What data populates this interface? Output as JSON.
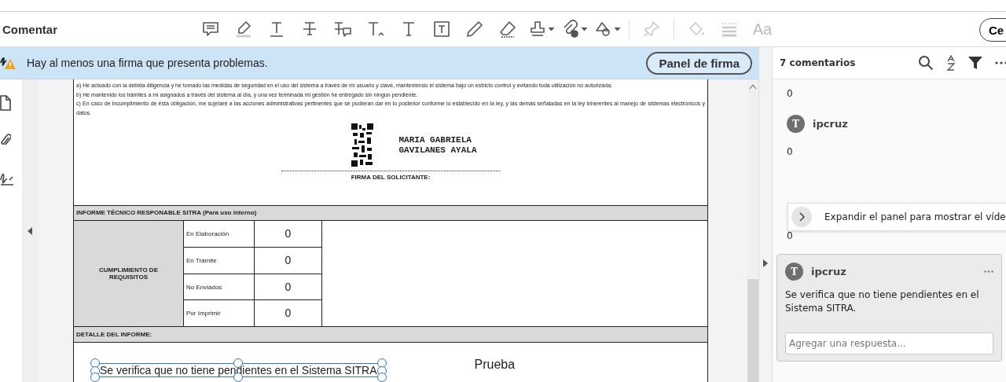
{
  "toolbar": {
    "title": "Comentar",
    "tools": [
      {
        "kind": "note",
        "disabled": false,
        "dropdown": false
      },
      {
        "kind": "highlight",
        "disabled": false,
        "dropdown": false
      },
      {
        "kind": "underline",
        "disabled": false,
        "dropdown": false
      },
      {
        "kind": "strike",
        "disabled": false,
        "dropdown": false
      },
      {
        "kind": "replace",
        "disabled": false,
        "dropdown": false
      },
      {
        "kind": "insert",
        "disabled": false,
        "dropdown": false
      },
      {
        "kind": "text",
        "disabled": false,
        "dropdown": false
      },
      {
        "kind": "textbox",
        "disabled": false,
        "dropdown": false
      },
      {
        "kind": "pencil",
        "disabled": false,
        "dropdown": false
      },
      {
        "kind": "eraser",
        "disabled": false,
        "dropdown": false
      },
      {
        "kind": "stamp",
        "disabled": false,
        "dropdown": true
      },
      {
        "kind": "attach",
        "disabled": false,
        "dropdown": true
      },
      {
        "kind": "shape",
        "disabled": false,
        "dropdown": true
      },
      {
        "kind": "separator"
      },
      {
        "kind": "pin",
        "disabled": true,
        "dropdown": false
      },
      {
        "kind": "separator"
      },
      {
        "kind": "fill",
        "disabled": true,
        "dropdown": false
      },
      {
        "kind": "lines",
        "disabled": true,
        "dropdown": false
      },
      {
        "kind": "font",
        "label": "Aa",
        "disabled": true,
        "dropdown": false
      }
    ],
    "close_button": "Ce"
  },
  "banner": {
    "message": "Hay al menos una firma que presenta problemas.",
    "button": "Panel de firma"
  },
  "document": {
    "paragraphs": [
      "a) He actuado con la debida diligencia y he tomado las medidas de seguridad en el uso del sistema a través de mi usuario y clave, manteniendo el sistema bajo un estricto control y evitando toda utilización no autorizada;",
      "b) He mantenido  los trámites a mi asignados a través del sistema al día, y una vez terminada mi gestión he entregado sin ningún pendiente.",
      "c) En caso de incumplimiento de ésta obligación, me sujetaré a las acciones administrativas pertinentes que se pudieran dar en lo posterior conforme lo establecido en la ley, y las demás señaladas en la ley inherentes al manejo de sistemas electrónicos y datos."
    ],
    "signer": [
      "MARIA GABRIELA",
      "GAVILANES AYALA"
    ],
    "signature_label": "FIRMA DEL SOLICITANTE:",
    "report_header": "INFORME TÉCNICO RESPONABLE SITRA (Para uso interno)",
    "requirements_label": "CUMPLIMIENTO DE REQUISITOS",
    "requirements": [
      {
        "label": "En Elaboración",
        "value": "0"
      },
      {
        "label": "En Trámite",
        "value": "0"
      },
      {
        "label": "No Enviados",
        "value": "0"
      },
      {
        "label": "Por Imprimir",
        "value": "0"
      }
    ],
    "detail_header": "DETALLE DEL INFORME:",
    "annotation": {
      "text": "Se verifica que no tiene pendientes en el Sistema SITRA",
      "selected": true
    },
    "note": "Prueba"
  },
  "comments_panel": {
    "title": "7 comentarios",
    "comments": [
      {
        "body": "0",
        "selected": false
      },
      {
        "initial": "T",
        "author": "ipcruz",
        "body": "0",
        "selected": false
      },
      {
        "body": "0",
        "selected": false
      },
      {
        "initial": "T",
        "author": "ipcruz",
        "body": "Se verifica que no tiene pendientes en el Sistema SITRA.",
        "reply_placeholder": "Agregar una respuesta...",
        "selected": true
      }
    ],
    "tooltip": "Expandir el panel para mostrar el víde"
  }
}
